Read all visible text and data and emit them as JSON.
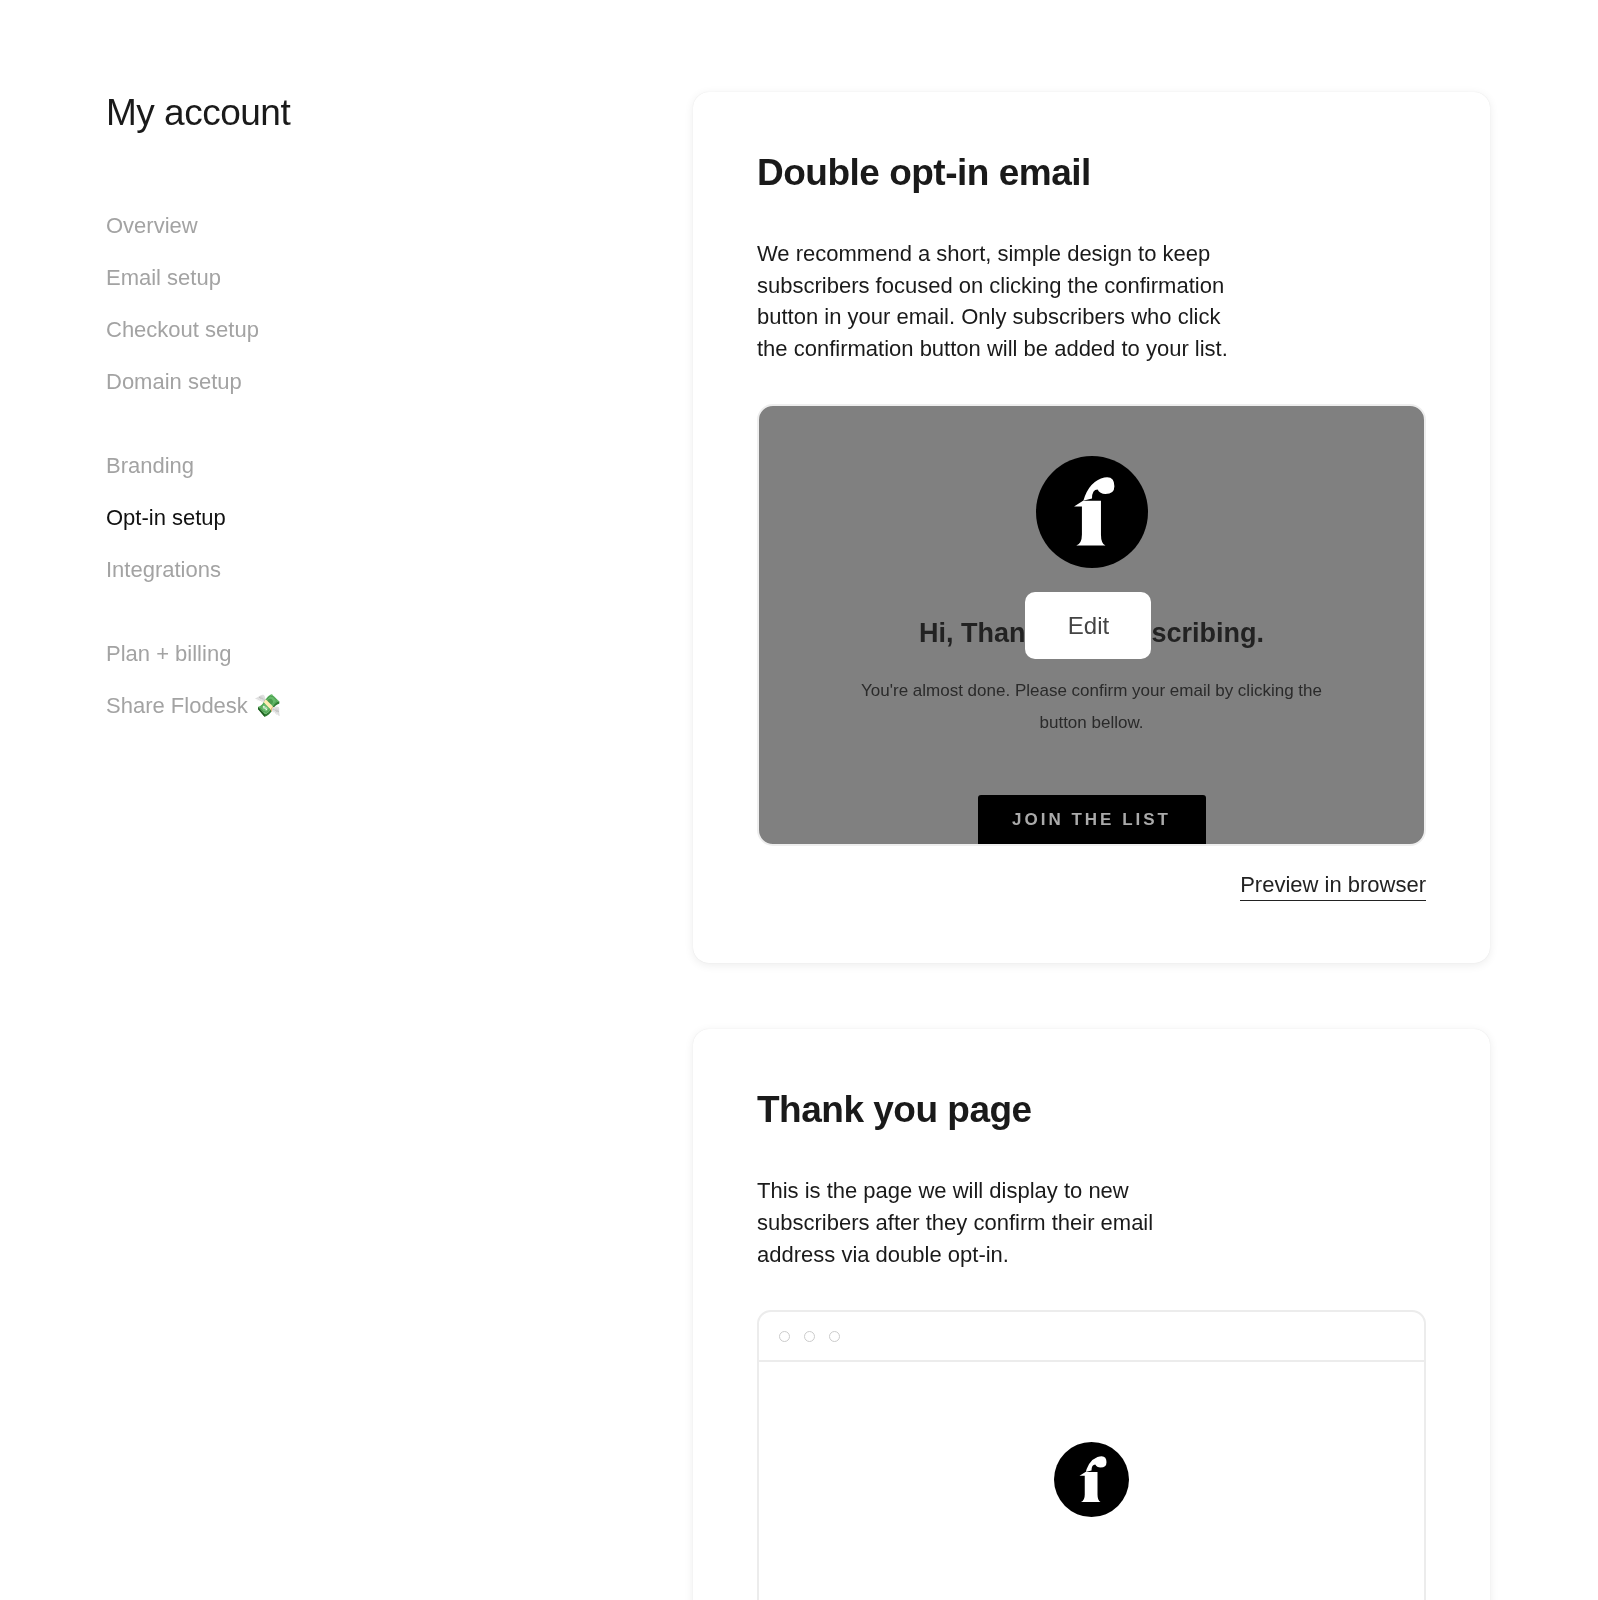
{
  "sidebar": {
    "title": "My account",
    "groups": [
      [
        {
          "label": "Overview",
          "selected": false
        },
        {
          "label": "Email setup",
          "selected": false
        },
        {
          "label": "Checkout setup",
          "selected": false
        },
        {
          "label": "Domain setup",
          "selected": false
        }
      ],
      [
        {
          "label": "Branding",
          "selected": false
        },
        {
          "label": "Opt-in setup",
          "selected": true
        },
        {
          "label": "Integrations",
          "selected": false
        }
      ],
      [
        {
          "label": "Plan + billing",
          "selected": false
        },
        {
          "label": "Share Flodesk 💸",
          "selected": false
        }
      ]
    ]
  },
  "cards": [
    {
      "kind": "email",
      "title": "Double opt-in email",
      "description": "We recommend a short, simple design to keep subscribers focused on clicking the confirmation button in your email. Only subscribers who click the confirmation button will be added to your list.",
      "preview": {
        "headline_start": "Hi, Than",
        "edit_button": "Edit",
        "headline_end": "scribing.",
        "body": "You're almost done. Please confirm your email by clicking the button bellow.",
        "cta": "JOIN THE LIST"
      },
      "link": "Preview in browser"
    },
    {
      "kind": "page",
      "title": "Thank you page",
      "description": "This is the page we will display to new subscribers after they confirm their email address via double opt-in."
    }
  ]
}
